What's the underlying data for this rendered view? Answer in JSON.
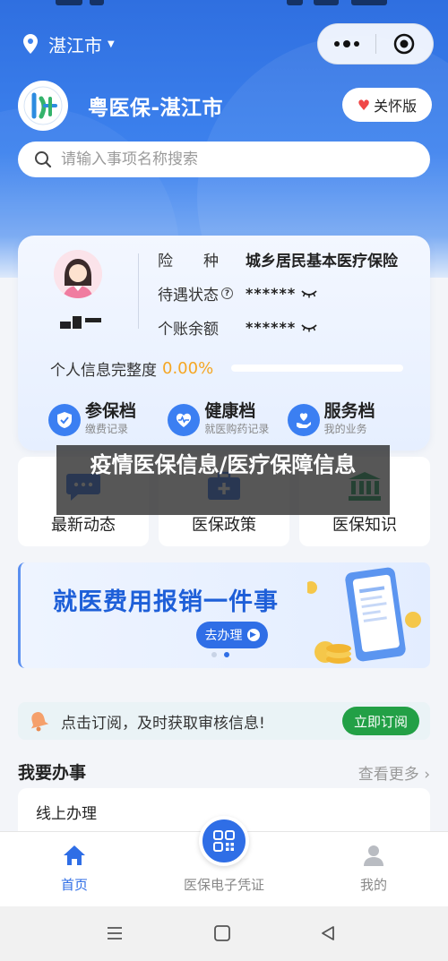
{
  "location": {
    "city": "湛江市"
  },
  "brand": {
    "name": "粤医保-湛江市"
  },
  "care_mode": {
    "label": "关怀版"
  },
  "search": {
    "placeholder": "请输入事项名称搜索"
  },
  "profile": {
    "rows": [
      {
        "label": "险　　种",
        "value": "城乡居民基本医疗保险"
      },
      {
        "label": "待遇状态",
        "value": "******"
      },
      {
        "label": "个账余额",
        "value": "******"
      }
    ],
    "completeness_label": "个人信息完整度",
    "completeness_value": "0.00%",
    "completeness_fraction": 0.0
  },
  "shortcuts": [
    {
      "title": "参保档",
      "subtitle": "缴费记录",
      "icon": "shield-check-icon"
    },
    {
      "title": "健康档",
      "subtitle": "就医购药记录",
      "icon": "heart-pulse-icon"
    },
    {
      "title": "服务档",
      "subtitle": "我的业务",
      "icon": "service-hand-icon"
    }
  ],
  "tiles": [
    {
      "label": "最新动态",
      "icon": "chat-bubble-icon"
    },
    {
      "label": "医保政策",
      "icon": "medical-kit-icon"
    },
    {
      "label": "医保知识",
      "icon": "institution-icon"
    }
  ],
  "overlay": {
    "text": "疫情医保信息/医疗保障信息"
  },
  "banner": {
    "title": "就医费用报销一件事",
    "button": "去办理"
  },
  "notice": {
    "text": "点击订阅，及时获取审核信息!",
    "button": "立即订阅"
  },
  "section": {
    "title": "我要办事",
    "more": "查看更多"
  },
  "online": {
    "label": "线上办理"
  },
  "tabbar": [
    {
      "label": "首页",
      "icon": "home-icon",
      "active": true
    },
    {
      "label": "医保电子凭证",
      "icon": "qr-code-icon",
      "active": false
    },
    {
      "label": "我的",
      "icon": "user-icon",
      "active": false
    }
  ],
  "colors": {
    "primary": "#2f6ee6",
    "accent": "#f5a623",
    "success": "#22a046"
  }
}
